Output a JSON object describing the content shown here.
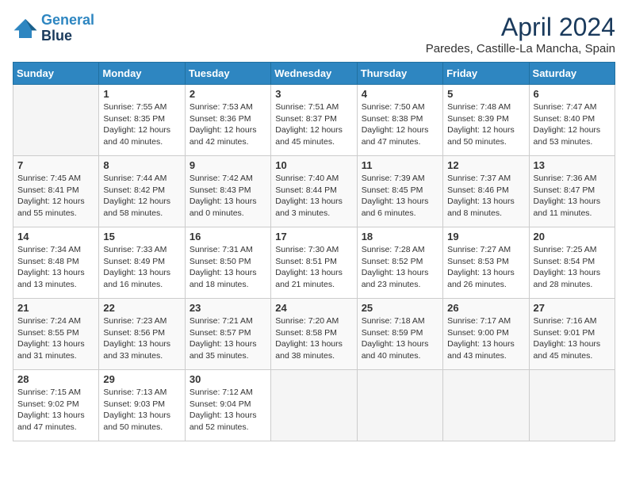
{
  "logo": {
    "line1": "General",
    "line2": "Blue"
  },
  "title": "April 2024",
  "location": "Paredes, Castille-La Mancha, Spain",
  "weekdays": [
    "Sunday",
    "Monday",
    "Tuesday",
    "Wednesday",
    "Thursday",
    "Friday",
    "Saturday"
  ],
  "weeks": [
    [
      {
        "day": "",
        "sunrise": "",
        "sunset": "",
        "daylight": ""
      },
      {
        "day": "1",
        "sunrise": "Sunrise: 7:55 AM",
        "sunset": "Sunset: 8:35 PM",
        "daylight": "Daylight: 12 hours and 40 minutes."
      },
      {
        "day": "2",
        "sunrise": "Sunrise: 7:53 AM",
        "sunset": "Sunset: 8:36 PM",
        "daylight": "Daylight: 12 hours and 42 minutes."
      },
      {
        "day": "3",
        "sunrise": "Sunrise: 7:51 AM",
        "sunset": "Sunset: 8:37 PM",
        "daylight": "Daylight: 12 hours and 45 minutes."
      },
      {
        "day": "4",
        "sunrise": "Sunrise: 7:50 AM",
        "sunset": "Sunset: 8:38 PM",
        "daylight": "Daylight: 12 hours and 47 minutes."
      },
      {
        "day": "5",
        "sunrise": "Sunrise: 7:48 AM",
        "sunset": "Sunset: 8:39 PM",
        "daylight": "Daylight: 12 hours and 50 minutes."
      },
      {
        "day": "6",
        "sunrise": "Sunrise: 7:47 AM",
        "sunset": "Sunset: 8:40 PM",
        "daylight": "Daylight: 12 hours and 53 minutes."
      }
    ],
    [
      {
        "day": "7",
        "sunrise": "Sunrise: 7:45 AM",
        "sunset": "Sunset: 8:41 PM",
        "daylight": "Daylight: 12 hours and 55 minutes."
      },
      {
        "day": "8",
        "sunrise": "Sunrise: 7:44 AM",
        "sunset": "Sunset: 8:42 PM",
        "daylight": "Daylight: 12 hours and 58 minutes."
      },
      {
        "day": "9",
        "sunrise": "Sunrise: 7:42 AM",
        "sunset": "Sunset: 8:43 PM",
        "daylight": "Daylight: 13 hours and 0 minutes."
      },
      {
        "day": "10",
        "sunrise": "Sunrise: 7:40 AM",
        "sunset": "Sunset: 8:44 PM",
        "daylight": "Daylight: 13 hours and 3 minutes."
      },
      {
        "day": "11",
        "sunrise": "Sunrise: 7:39 AM",
        "sunset": "Sunset: 8:45 PM",
        "daylight": "Daylight: 13 hours and 6 minutes."
      },
      {
        "day": "12",
        "sunrise": "Sunrise: 7:37 AM",
        "sunset": "Sunset: 8:46 PM",
        "daylight": "Daylight: 13 hours and 8 minutes."
      },
      {
        "day": "13",
        "sunrise": "Sunrise: 7:36 AM",
        "sunset": "Sunset: 8:47 PM",
        "daylight": "Daylight: 13 hours and 11 minutes."
      }
    ],
    [
      {
        "day": "14",
        "sunrise": "Sunrise: 7:34 AM",
        "sunset": "Sunset: 8:48 PM",
        "daylight": "Daylight: 13 hours and 13 minutes."
      },
      {
        "day": "15",
        "sunrise": "Sunrise: 7:33 AM",
        "sunset": "Sunset: 8:49 PM",
        "daylight": "Daylight: 13 hours and 16 minutes."
      },
      {
        "day": "16",
        "sunrise": "Sunrise: 7:31 AM",
        "sunset": "Sunset: 8:50 PM",
        "daylight": "Daylight: 13 hours and 18 minutes."
      },
      {
        "day": "17",
        "sunrise": "Sunrise: 7:30 AM",
        "sunset": "Sunset: 8:51 PM",
        "daylight": "Daylight: 13 hours and 21 minutes."
      },
      {
        "day": "18",
        "sunrise": "Sunrise: 7:28 AM",
        "sunset": "Sunset: 8:52 PM",
        "daylight": "Daylight: 13 hours and 23 minutes."
      },
      {
        "day": "19",
        "sunrise": "Sunrise: 7:27 AM",
        "sunset": "Sunset: 8:53 PM",
        "daylight": "Daylight: 13 hours and 26 minutes."
      },
      {
        "day": "20",
        "sunrise": "Sunrise: 7:25 AM",
        "sunset": "Sunset: 8:54 PM",
        "daylight": "Daylight: 13 hours and 28 minutes."
      }
    ],
    [
      {
        "day": "21",
        "sunrise": "Sunrise: 7:24 AM",
        "sunset": "Sunset: 8:55 PM",
        "daylight": "Daylight: 13 hours and 31 minutes."
      },
      {
        "day": "22",
        "sunrise": "Sunrise: 7:23 AM",
        "sunset": "Sunset: 8:56 PM",
        "daylight": "Daylight: 13 hours and 33 minutes."
      },
      {
        "day": "23",
        "sunrise": "Sunrise: 7:21 AM",
        "sunset": "Sunset: 8:57 PM",
        "daylight": "Daylight: 13 hours and 35 minutes."
      },
      {
        "day": "24",
        "sunrise": "Sunrise: 7:20 AM",
        "sunset": "Sunset: 8:58 PM",
        "daylight": "Daylight: 13 hours and 38 minutes."
      },
      {
        "day": "25",
        "sunrise": "Sunrise: 7:18 AM",
        "sunset": "Sunset: 8:59 PM",
        "daylight": "Daylight: 13 hours and 40 minutes."
      },
      {
        "day": "26",
        "sunrise": "Sunrise: 7:17 AM",
        "sunset": "Sunset: 9:00 PM",
        "daylight": "Daylight: 13 hours and 43 minutes."
      },
      {
        "day": "27",
        "sunrise": "Sunrise: 7:16 AM",
        "sunset": "Sunset: 9:01 PM",
        "daylight": "Daylight: 13 hours and 45 minutes."
      }
    ],
    [
      {
        "day": "28",
        "sunrise": "Sunrise: 7:15 AM",
        "sunset": "Sunset: 9:02 PM",
        "daylight": "Daylight: 13 hours and 47 minutes."
      },
      {
        "day": "29",
        "sunrise": "Sunrise: 7:13 AM",
        "sunset": "Sunset: 9:03 PM",
        "daylight": "Daylight: 13 hours and 50 minutes."
      },
      {
        "day": "30",
        "sunrise": "Sunrise: 7:12 AM",
        "sunset": "Sunset: 9:04 PM",
        "daylight": "Daylight: 13 hours and 52 minutes."
      },
      {
        "day": "",
        "sunrise": "",
        "sunset": "",
        "daylight": ""
      },
      {
        "day": "",
        "sunrise": "",
        "sunset": "",
        "daylight": ""
      },
      {
        "day": "",
        "sunrise": "",
        "sunset": "",
        "daylight": ""
      },
      {
        "day": "",
        "sunrise": "",
        "sunset": "",
        "daylight": ""
      }
    ]
  ]
}
